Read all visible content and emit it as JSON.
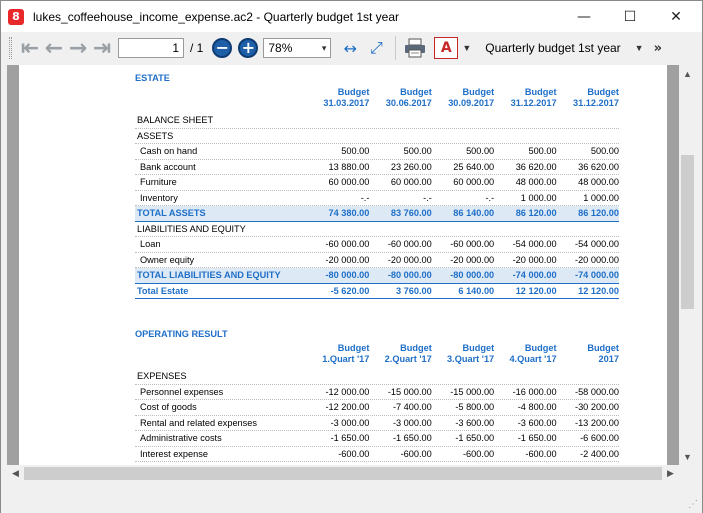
{
  "window": {
    "title": "lukes_coffeehouse_income_expense.ac2 - Quarterly budget 1st year",
    "app_icon": "8",
    "minimize": "—",
    "maximize": "☐",
    "close": "✕"
  },
  "toolbar": {
    "first_page": "⇤",
    "prev_page": "←",
    "next_page": "→",
    "last_page": "⇥",
    "page_value": "1",
    "page_total": "/ 1",
    "zoom_out": "−",
    "zoom_in": "+",
    "zoom_value": "78%",
    "zoom_caret": "▾",
    "fit_width": "↔",
    "fit_page": "⤢",
    "pdf": "A",
    "pdf_caret": "▼",
    "report_name": "Quarterly budget 1st year",
    "report_caret": "▼",
    "more": "»"
  },
  "scroll": {
    "up": "▲",
    "down": "▼",
    "left": "◀",
    "right": "▶"
  },
  "estate": {
    "title": "ESTATE",
    "columns": [
      [
        "Budget",
        "31.03.2017"
      ],
      [
        "Budget",
        "30.06.2017"
      ],
      [
        "Budget",
        "30.09.2017"
      ],
      [
        "Budget",
        "31.12.2017"
      ],
      [
        "Budget",
        "31.12.2017"
      ]
    ],
    "rows": [
      {
        "type": "heading",
        "label": "BALANCE SHEET",
        "values": [
          "",
          "",
          "",
          "",
          ""
        ]
      },
      {
        "type": "heading",
        "label": "ASSETS",
        "values": [
          "",
          "",
          "",
          "",
          ""
        ]
      },
      {
        "type": "indent",
        "label": "Cash on hand",
        "values": [
          "500.00",
          "500.00",
          "500.00",
          "500.00",
          "500.00"
        ]
      },
      {
        "type": "indent",
        "label": "Bank account",
        "values": [
          "13 880.00",
          "23 260.00",
          "25 640.00",
          "36 620.00",
          "36 620.00"
        ]
      },
      {
        "type": "indent",
        "label": "Furniture",
        "values": [
          "60 000.00",
          "60 000.00",
          "60 000.00",
          "48 000.00",
          "48 000.00"
        ]
      },
      {
        "type": "indent",
        "label": "Inventory",
        "values": [
          "-.-",
          "-.-",
          "-.-",
          "1 000.00",
          "1 000.00"
        ]
      },
      {
        "type": "total",
        "label": "TOTAL ASSETS",
        "values": [
          "74 380.00",
          "83 760.00",
          "86 140.00",
          "86 120.00",
          "86 120.00"
        ]
      },
      {
        "type": "heading",
        "label": "LIABILITIES AND EQUITY",
        "values": [
          "",
          "",
          "",
          "",
          ""
        ]
      },
      {
        "type": "indent",
        "label": "Loan",
        "values": [
          "-60 000.00",
          "-60 000.00",
          "-60 000.00",
          "-54 000.00",
          "-54 000.00"
        ]
      },
      {
        "type": "indent",
        "label": "Owner equity",
        "values": [
          "-20 000.00",
          "-20 000.00",
          "-20 000.00",
          "-20 000.00",
          "-20 000.00"
        ]
      },
      {
        "type": "total",
        "label": "TOTAL LIABILITIES AND EQUITY",
        "values": [
          "-80 000.00",
          "-80 000.00",
          "-80 000.00",
          "-74 000.00",
          "-74 000.00"
        ]
      },
      {
        "type": "grand",
        "label": "Total Estate",
        "values": [
          "-5 620.00",
          "3 760.00",
          "6 140.00",
          "12 120.00",
          "12 120.00"
        ]
      }
    ]
  },
  "operating": {
    "title": "OPERATING RESULT",
    "columns": [
      [
        "Budget",
        "1.Quart '17"
      ],
      [
        "Budget",
        "2.Quart '17"
      ],
      [
        "Budget",
        "3.Quart '17"
      ],
      [
        "Budget",
        "4.Quart '17"
      ],
      [
        "Budget",
        "2017"
      ]
    ],
    "rows": [
      {
        "type": "heading",
        "label": "EXPENSES",
        "values": [
          "",
          "",
          "",
          "",
          ""
        ]
      },
      {
        "type": "indent",
        "label": "Personnel expenses",
        "values": [
          "-12 000.00",
          "-15 000.00",
          "-15 000.00",
          "-16 000.00",
          "-58 000.00"
        ]
      },
      {
        "type": "indent",
        "label": "Cost of goods",
        "values": [
          "-12 200.00",
          "-7 400.00",
          "-5 800.00",
          "-4 800.00",
          "-30 200.00"
        ]
      },
      {
        "type": "indent",
        "label": "Rental and related expenses",
        "values": [
          "-3 000.00",
          "-3 000.00",
          "-3 600.00",
          "-3 600.00",
          "-13 200.00"
        ]
      },
      {
        "type": "indent",
        "label": "Administrative costs",
        "values": [
          "-1 650.00",
          "-1 650.00",
          "-1 650.00",
          "-1 650.00",
          "-6 600.00"
        ]
      },
      {
        "type": "indent",
        "label": "Interest expense",
        "values": [
          "-600.00",
          "-600.00",
          "-600.00",
          "-600.00",
          "-2 400.00"
        ]
      }
    ]
  },
  "colors": {
    "accent": "#1f6fc8",
    "total_row_bg": "#dde9f5"
  }
}
